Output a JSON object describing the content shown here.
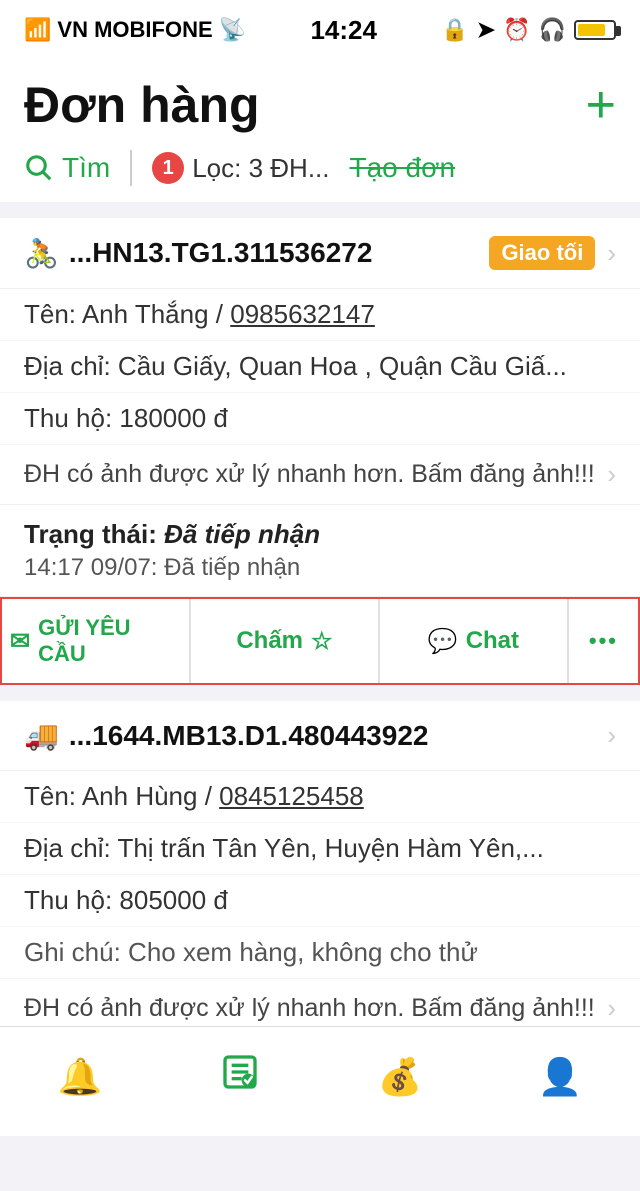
{
  "statusBar": {
    "carrier": "VN MOBIFONE",
    "time": "14:24",
    "icons": [
      "location",
      "alarm",
      "headphones"
    ]
  },
  "header": {
    "title": "Đơn hàng",
    "plusLabel": "+",
    "searchLabel": "Tìm",
    "filterBadge": "1",
    "filterLabel": "Lọc: 3 ĐH...",
    "createLabel": "Tạo đơn"
  },
  "orders": [
    {
      "icon": "🚴",
      "id": "...HN13.TG1.311536272",
      "statusBadge": "Giao tối",
      "name": "Anh Thắng",
      "phone": "0985632147",
      "address": "Địa chỉ: Cầu Giấy, Quan Hoa , Quận Cầu Giấ...",
      "collection": "Thu hộ: 180000 đ",
      "imagePrompt": "ĐH có ảnh được xử lý nhanh hơn. Bấm đăng ảnh!!!",
      "statusTitle": "Trạng thái:",
      "statusValue": "Đã tiếp nhận",
      "statusTime": "14:17 09/07: Đã tiếp nhận",
      "actions": {
        "sendRequest": "GỬI YÊU CẦU",
        "cham": "Chấm",
        "chat": "Chat",
        "more": "•••"
      }
    },
    {
      "icon": "🚚",
      "id": "...1644.MB13.D1.480443922",
      "statusBadge": "",
      "name": "Anh Hùng",
      "phone": "0845125458",
      "address": "Địa chỉ: Thị trấn Tân Yên, Huyện Hàm Yên,...",
      "collection": "Thu hộ: 805000 đ",
      "note": "Ghi chú: Cho xem hàng, không cho thử",
      "imagePrompt": "ĐH có ảnh được xử lý nhanh hơn. Bấm đăng ảnh!!!",
      "statusTitle": "",
      "statusValue": "",
      "statusTime": ""
    }
  ],
  "tabBar": {
    "items": [
      {
        "icon": "🔔",
        "label": "",
        "active": false
      },
      {
        "icon": "📋",
        "label": "",
        "active": true
      },
      {
        "icon": "💰",
        "label": "",
        "active": false
      },
      {
        "icon": "👤",
        "label": "",
        "active": false
      }
    ]
  }
}
